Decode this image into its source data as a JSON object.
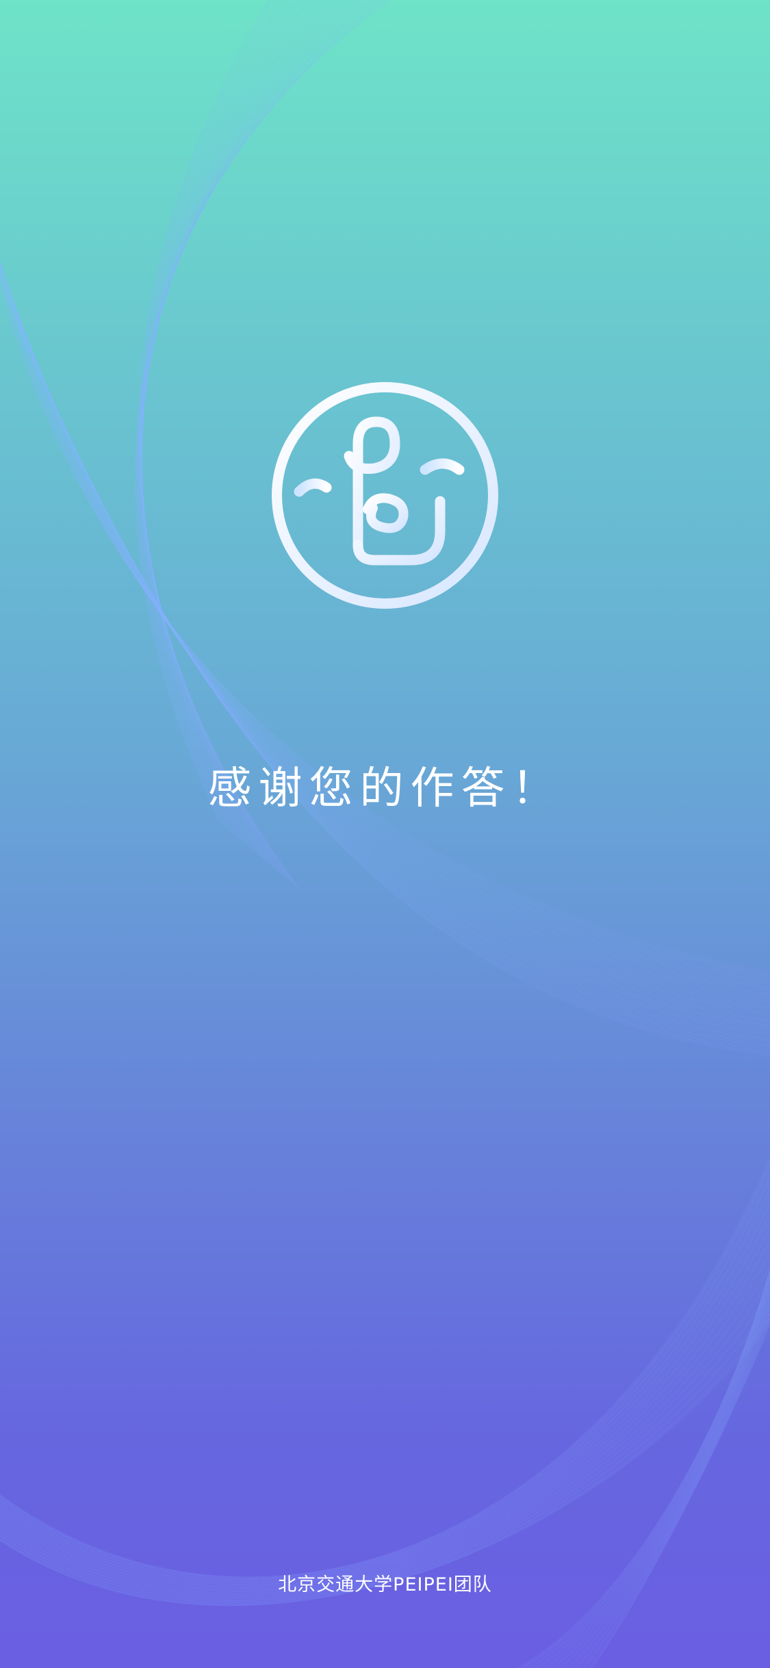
{
  "screen": {
    "thanks_text": "感谢您的作答！",
    "footer_text": "北京交通大学PEIPEI团队",
    "logo_icon": "peipei-face-logo-icon"
  },
  "colors": {
    "gradient_top": "#6ee3c8",
    "gradient_bottom": "#6a5ee3",
    "text": "#ffffff"
  }
}
